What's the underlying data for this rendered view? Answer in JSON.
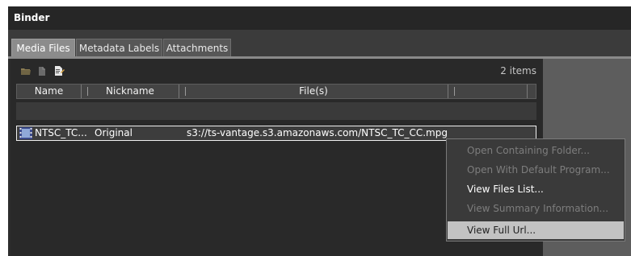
{
  "window": {
    "title": "Binder"
  },
  "tabs": [
    {
      "label": "Media Files",
      "active": true
    },
    {
      "label": "Metadata Labels",
      "active": false
    },
    {
      "label": "Attachments",
      "active": false
    }
  ],
  "toolbar": {
    "icons": [
      "open-folder-icon",
      "new-file-icon",
      "edit-file-icon"
    ],
    "items_count": "2 items"
  },
  "table": {
    "columns": [
      "Name",
      "Nickname",
      "File(s)",
      ""
    ],
    "rows": [
      {
        "icon": "film-icon",
        "name": "NTSC_TC...",
        "nickname": "Original",
        "file": "s3://ts-vantage.s3.amazonaws.com/NTSC_TC_CC.mpg"
      }
    ]
  },
  "context_menu": {
    "items": [
      {
        "label": "Open Containing Folder...",
        "enabled": false
      },
      {
        "label": "Open With Default Program...",
        "enabled": false
      },
      {
        "label": "View Files List...",
        "enabled": true
      },
      {
        "label": "View Summary Information...",
        "enabled": false
      },
      {
        "label": "View Full Url...",
        "enabled": true,
        "highlighted": true
      }
    ]
  },
  "colors": {
    "title_bar": "#262626",
    "active_tab": "#8c8c8c",
    "menu_highlight": "#c2c2c2"
  }
}
